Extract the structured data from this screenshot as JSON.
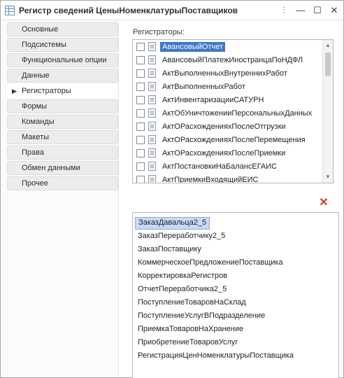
{
  "window": {
    "title": "Регистр сведений ЦеныНоменклатурыПоставщиков",
    "menu_label": "⋮",
    "minimize_label": "—",
    "maximize_label": "☐",
    "close_label": "✕"
  },
  "tabs": [
    {
      "label": "Основные"
    },
    {
      "label": "Подсистемы"
    },
    {
      "label": "Функциональные опции"
    },
    {
      "label": "Данные"
    },
    {
      "label": "Регистраторы",
      "active": true
    },
    {
      "label": "Формы"
    },
    {
      "label": "Команды"
    },
    {
      "label": "Макеты"
    },
    {
      "label": "Права"
    },
    {
      "label": "Обмен данными"
    },
    {
      "label": "Прочее"
    }
  ],
  "registrators": {
    "label": "Регистраторы:",
    "items": [
      "АвансовыйОтчет",
      "АвансовыйПлатежИностранцаПоНДФЛ",
      "АктВыполненныхВнутреннихРабот",
      "АктВыполненныхРабот",
      "АктИнвентаризацииСАТУРН",
      "АктОбУничтоженииПерсональныхДанных",
      "АктОРасхожденияхПослеОтгрузки",
      "АктОРасхожденияхПослеПеремещения",
      "АктОРасхожденияхПослеПриемки",
      "АктПостановкиНаБалансЕГАИС",
      "АктПриемкиВходящийЕИС"
    ],
    "selected_index": 0,
    "scroll_up": "▲",
    "scroll_down": "▼"
  },
  "delete_icon": "✕",
  "selected_docs": {
    "items": [
      "ЗаказДавальца2_5",
      "ЗаказПереработчику2_5",
      "ЗаказПоставщику",
      "КоммерческоеПредложениеПоставщика",
      "КорректировкаРегистров",
      "ОтчетПереработчика2_5",
      "ПоступлениеТоваровНаСклад",
      "ПоступлениеУслугВПодразделение",
      "ПриемкаТоваровНаХранение",
      "ПриобретениеТоваровУслуг",
      "РегистрацияЦенНоменклатурыПоставщика"
    ],
    "selected_index": 0
  },
  "colors": {
    "selection": "#3f78c7",
    "selection_light": "#c8d9f4",
    "delete": "#d83a2e"
  }
}
